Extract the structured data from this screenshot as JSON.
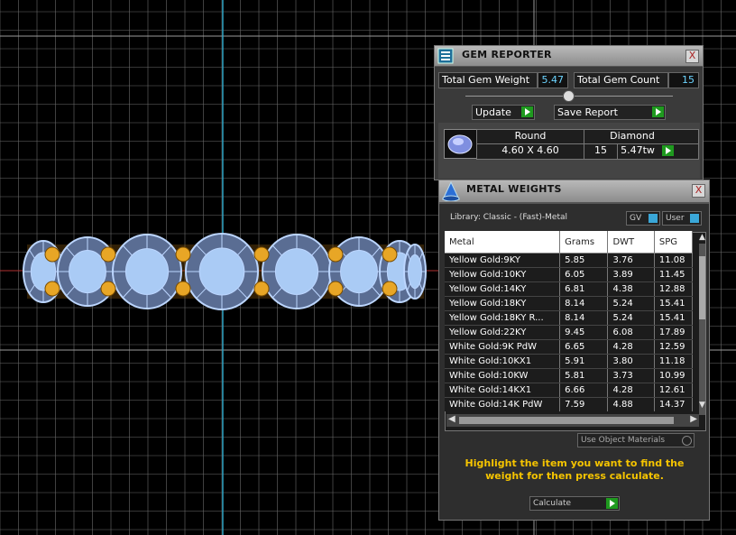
{
  "gem_reporter": {
    "title": "GEM REPORTER",
    "close_label": "X",
    "total_gem_weight_label": "Total Gem Weight",
    "total_gem_weight_value": "5.47",
    "total_gem_count_label": "Total Gem Count",
    "total_gem_count_value": "15",
    "update_label": "Update",
    "save_report_label": "Save Report",
    "gem": {
      "shape": "Round",
      "size": "4.60 X 4.60",
      "type": "Diamond",
      "count": "15",
      "weight": "5.47tw"
    }
  },
  "metal_weights": {
    "title": "METAL WEIGHTS",
    "close_label": "X",
    "library_label": "Library: Classic - (Fast)-Metal",
    "gv_label": "GV",
    "user_label": "User",
    "columns": [
      "Metal",
      "Grams",
      "DWT",
      "SPG"
    ],
    "rows": [
      [
        "Yellow Gold:9KY",
        "5.85",
        "3.76",
        "11.08"
      ],
      [
        "Yellow Gold:10KY",
        "6.05",
        "3.89",
        "11.45"
      ],
      [
        "Yellow Gold:14KY",
        "6.81",
        "4.38",
        "12.88"
      ],
      [
        "Yellow Gold:18KY",
        "8.14",
        "5.24",
        "15.41"
      ],
      [
        "Yellow Gold:18KY R...",
        "8.14",
        "5.24",
        "15.41"
      ],
      [
        "Yellow Gold:22KY",
        "9.45",
        "6.08",
        "17.89"
      ],
      [
        "White Gold:9K PdW",
        "6.65",
        "4.28",
        "12.59"
      ],
      [
        "White Gold:10KX1",
        "5.91",
        "3.80",
        "11.18"
      ],
      [
        "White Gold:10KW",
        "5.81",
        "3.73",
        "10.99"
      ],
      [
        "White Gold:14KX1",
        "6.66",
        "4.28",
        "12.61"
      ],
      [
        "White Gold:14K PdW",
        "7.59",
        "4.88",
        "14.37"
      ]
    ],
    "use_object_materials_label": "Use Object Materials",
    "instruction": "Highlight the item you want to find the weight for then press calculate.",
    "calculate_label": "Calculate"
  },
  "colors": {
    "grid": "#6b6b6b",
    "axis": "#2aa6c8",
    "gem": "#bcd6ff",
    "metal": "#e8a626",
    "instruction": "#f5c400"
  },
  "icons": {
    "gem_reporter": "gem-report-icon",
    "metal_weights": "metal-cone-icon",
    "gem_thumbnail": "round-diamond-icon"
  }
}
